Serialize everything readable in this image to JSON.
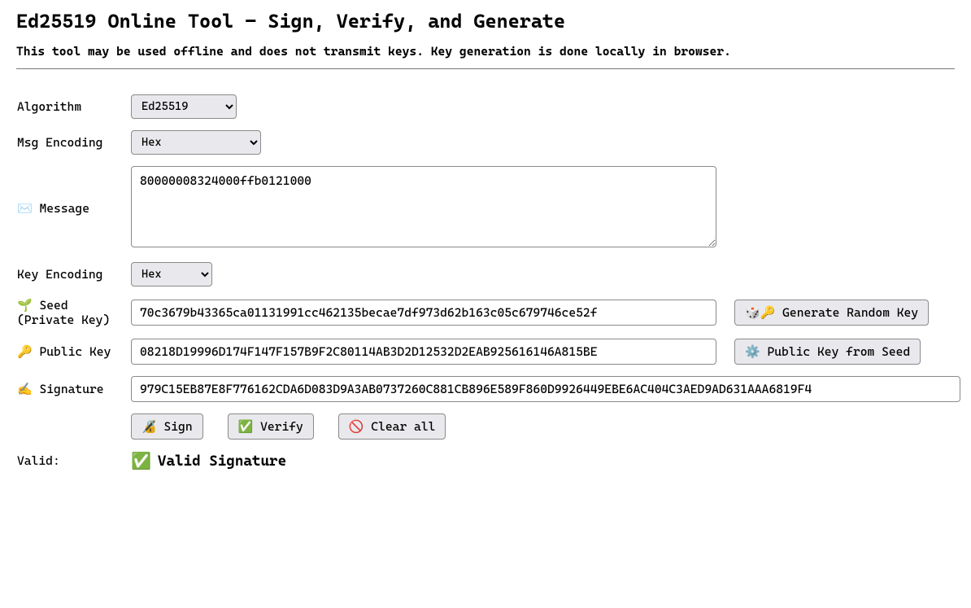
{
  "heading": "Ed25519 Online Tool - Sign, Verify, and Generate",
  "subtitle": "This tool may be used offline and does not transmit keys. Key generation is done locally in browser.",
  "labels": {
    "algorithm": "Algorithm",
    "msg_encoding": "Msg Encoding",
    "message": "✉️ Message",
    "key_encoding": "Key Encoding",
    "seed": "🌱 Seed (Private Key)",
    "public_key": "🔑 Public Key",
    "signature": "✍️ Signature",
    "valid": "Valid:"
  },
  "select": {
    "algorithm": "Ed25519",
    "msg_encoding": "Hex",
    "key_encoding": "Hex"
  },
  "values": {
    "message": "80000008324000ffb0121000",
    "seed": "70c3679b43365ca01131991cc462135becae7df973d62b163c05c679746ce52f",
    "public_key": "08218D19996D174F147F157B9F2C80114AB3D2D12532D2EAB925616146A815BE",
    "signature": "979C15EB87E8F776162CDA6D083D9A3AB0737260C881CB896E589F860D9926449EBE6AC404C3AED9AD631AAA6819F4"
  },
  "buttons": {
    "gen_key": "🎲🔑 Generate Random Key",
    "pub_from_seed": "⚙️ Public Key from Seed",
    "sign": "🔏 Sign",
    "verify": "✅ Verify",
    "clear": "🚫 Clear all"
  },
  "result": {
    "icon": "✅",
    "text": "Valid Signature"
  }
}
